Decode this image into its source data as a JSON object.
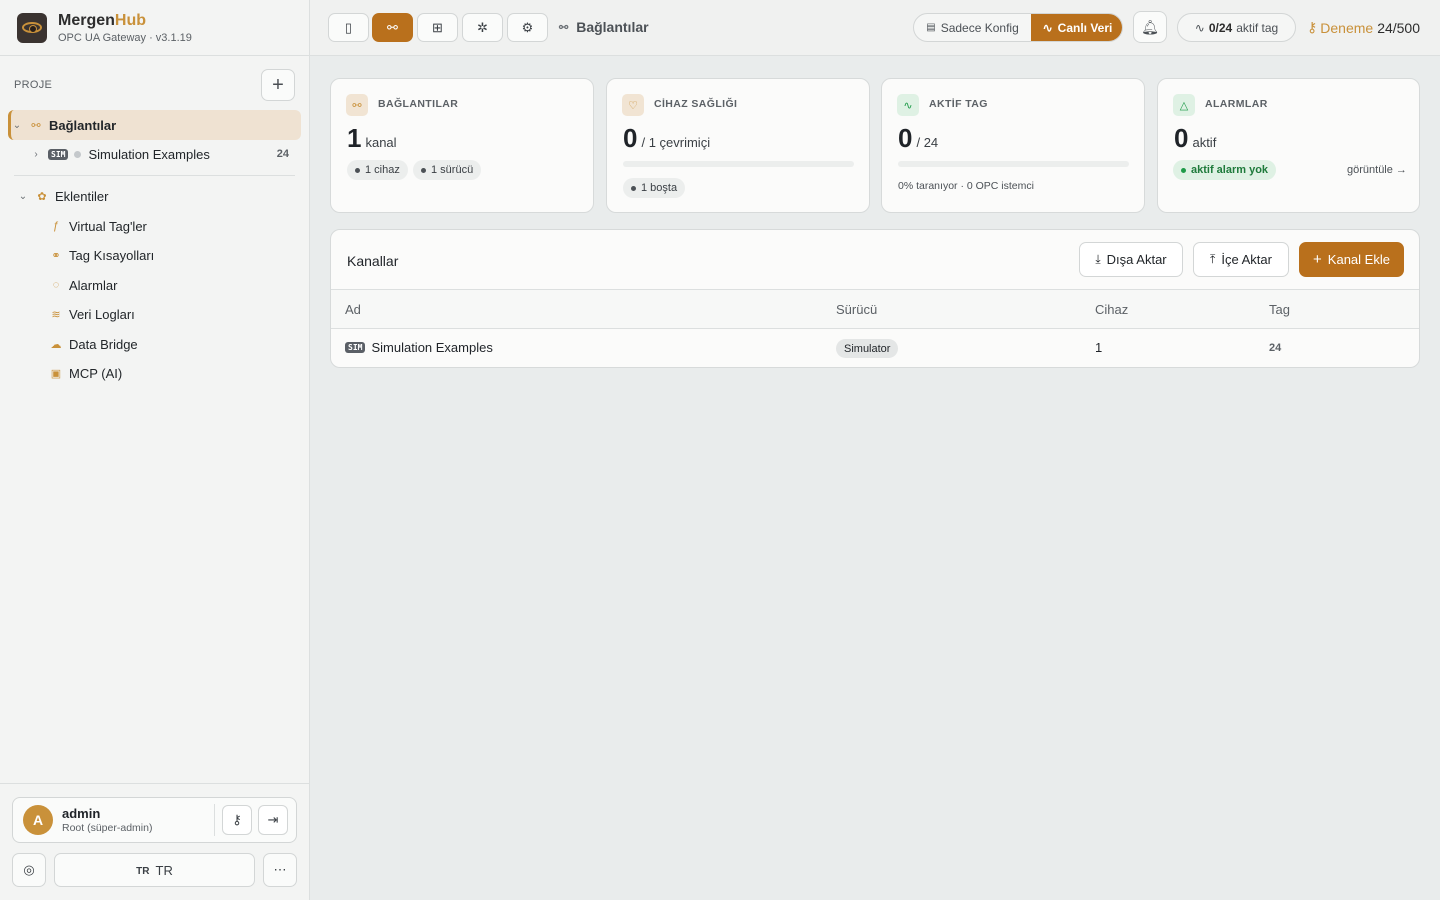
{
  "brand": {
    "name_main": "Mergen",
    "name_accent": "Hub",
    "subtitle": "OPC UA Gateway · v3.1.19"
  },
  "sidebar": {
    "project_label": "PROJE",
    "connections": {
      "label": "Bağlantılar"
    },
    "channel": {
      "badge": "SIM",
      "label": "Simulation Examples",
      "count": "24"
    },
    "plugins": {
      "label": "Eklentiler",
      "items": [
        {
          "label": "Virtual Tag'ler",
          "icon": "function-icon"
        },
        {
          "label": "Tag Kısayolları",
          "icon": "link-icon"
        },
        {
          "label": "Alarmlar",
          "icon": "alarm-icon"
        },
        {
          "label": "Veri Logları",
          "icon": "database-icon"
        },
        {
          "label": "Data Bridge",
          "icon": "cloud-icon"
        },
        {
          "label": "MCP (AI)",
          "icon": "bot-icon"
        }
      ]
    },
    "user": {
      "initial": "A",
      "name": "admin",
      "role": "Root (süper-admin)"
    },
    "language": {
      "flag": "TR",
      "label": "TR"
    }
  },
  "topbar": {
    "breadcrumb": "Bağlantılar",
    "mode_config": "Sadece Konfig",
    "mode_live": "Canlı Veri",
    "active_tags_value": "0/24",
    "active_tags_label": "aktif tag",
    "trial_label": "Deneme",
    "trial_value": "24/500"
  },
  "cards": {
    "connections": {
      "title": "BAĞLANTILAR",
      "value": "1",
      "unit": "kanal",
      "chip1": "1 cihaz",
      "chip2": "1 sürücü"
    },
    "health": {
      "title": "CİHAZ SAĞLIĞI",
      "value": "0",
      "unit": "/ 1 çevrimiçi",
      "progress": 0,
      "chip": "1 boşta"
    },
    "tags": {
      "title": "AKTİF TAG",
      "value": "0",
      "unit": "/ 24",
      "progress": 0,
      "note": "0% taranıyor · 0 OPC istemci"
    },
    "alarms": {
      "title": "ALARMLAR",
      "value": "0",
      "unit": "aktif",
      "chip": "aktif alarm yok",
      "link": "görüntüle →"
    }
  },
  "channels": {
    "title": "Kanallar",
    "export_label": "Dışa Aktar",
    "import_label": "İçe Aktar",
    "add_label": "Kanal Ekle",
    "columns": {
      "name": "Ad",
      "driver": "Sürücü",
      "device": "Cihaz",
      "tag": "Tag"
    },
    "rows": [
      {
        "badge": "SIM",
        "name": "Simulation Examples",
        "driver": "Simulator",
        "devices": "1",
        "tags": "24"
      }
    ]
  },
  "colors": {
    "accent": "#b9701c",
    "brand_gold": "#c9913a",
    "success": "#1e7a3b"
  }
}
